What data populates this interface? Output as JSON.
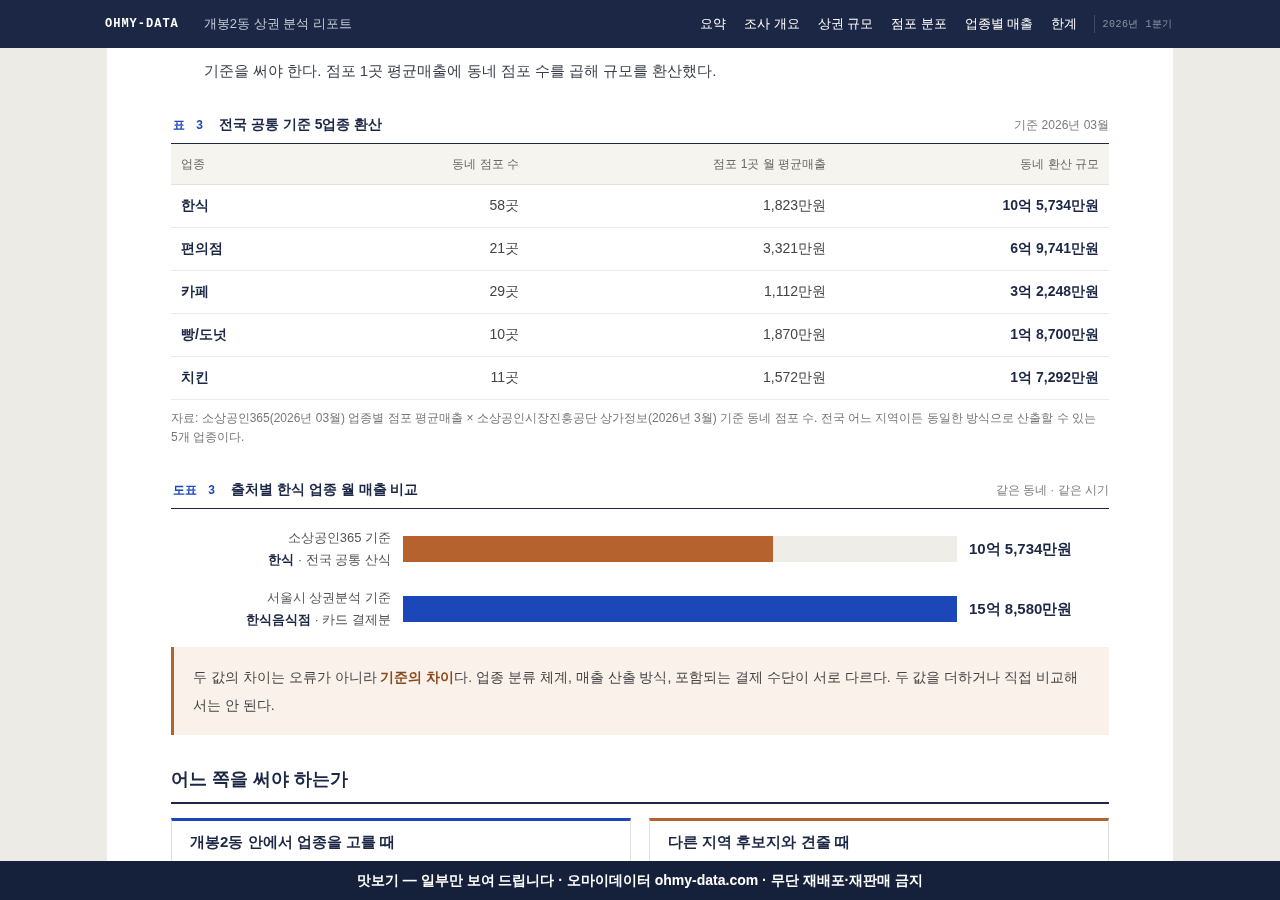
{
  "header": {
    "logo": "OHMY-DATA",
    "subtitle": "개봉2동 상권 분석 리포트",
    "nav": [
      "요약",
      "조사 개요",
      "상권 규모",
      "점포 분포",
      "업종별 매출",
      "한계"
    ],
    "period": "2026년 1분기"
  },
  "intro_text": "기준을 써야 한다. 점포 1곳 평균매출에 동네 점포 수를 곱해 규모를 환산했다.",
  "table": {
    "label": "표 3",
    "title": "전국 공통 기준 5업종 환산",
    "meta": "기준 2026년 03월",
    "columns": [
      "업종",
      "동네 점포 수",
      "점포 1곳 월 평균매출",
      "동네 환산 규모"
    ],
    "rows": [
      [
        "한식",
        "58곳",
        "1,823만원",
        "10억 5,734만원"
      ],
      [
        "편의점",
        "21곳",
        "3,321만원",
        "6억 9,741만원"
      ],
      [
        "카페",
        "29곳",
        "1,112만원",
        "3억 2,248만원"
      ],
      [
        "빵/도넛",
        "10곳",
        "1,870만원",
        "1억 8,700만원"
      ],
      [
        "치킨",
        "11곳",
        "1,572만원",
        "1억 7,292만원"
      ]
    ],
    "note": "자료: 소상공인365(2026년 03월) 업종별 점포 평균매출 × 소상공인시장진흥공단 상가정보(2026년 3월) 기준 동네 점포 수. 전국 어느 지역이든 동일한 방식으로 산출할 수 있는 5개 업종이다."
  },
  "figure": {
    "label": "도표 3",
    "title": "출처별 한식 업종 월 매출 비교",
    "meta": "같은 동네 · 같은 시기",
    "bars": [
      {
        "source": "소상공인365 기준",
        "detail": "**한식** · 전국 공통 산식",
        "level": 0.667,
        "value": "10억 5,734만원",
        "color": "#b5622e"
      },
      {
        "source": "서울시 상권분석 기준",
        "detail": "**한식음식점** · 카드 결제분",
        "level": 1,
        "value": "15억 8,580만원",
        "color": "#1c47b8"
      }
    ]
  },
  "callout": {
    "text": "두 값의 차이는 오류가 아니라 **기준의 차이**다. 업종 분류 체계, 매출 산출 방식, 포함되는 결제 수단이 서로 다르다. 두 값을 더하거나 직접 비교해서는 안 된다."
  },
  "section": {
    "heading": "어느 쪽을 써야 하는가",
    "cards": [
      {
        "title": "개봉2동 안에서 업종을 고를 때",
        "color": "#1c47b8"
      },
      {
        "title": "다른 지역 후보지와 견줄 때",
        "color": "#b5622e"
      }
    ]
  },
  "footer": {
    "text": "맛보기 — 일부만 보여 드립니다 · 오마이데이터 ohmy-data.com · 무단 재배포·재판매 금지"
  }
}
